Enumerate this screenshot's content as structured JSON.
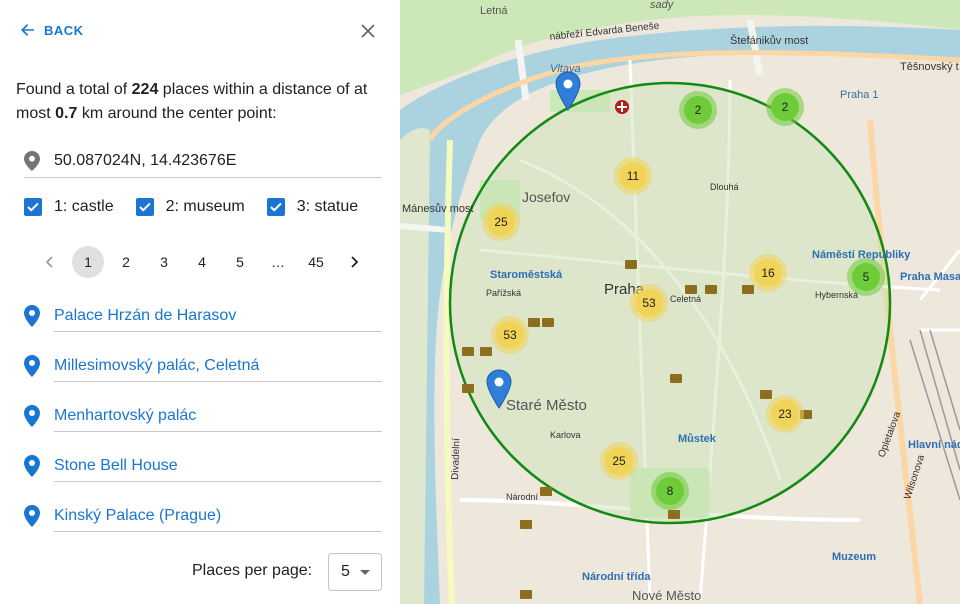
{
  "panel": {
    "back_label": "BACK",
    "summary": {
      "prefix": "Found a total of",
      "count": "224",
      "middle": "places within a distance of at most",
      "distance": "0.7",
      "suffix": "km around the center point:"
    },
    "center_point": "50.087024N, 14.423676E",
    "filters": [
      {
        "label": "1: castle",
        "checked": true
      },
      {
        "label": "2: museum",
        "checked": true
      },
      {
        "label": "3: statue",
        "checked": true
      }
    ],
    "pagination": {
      "current": "1",
      "pages": [
        "1",
        "2",
        "3",
        "4",
        "5",
        "…",
        "45"
      ]
    },
    "results": [
      "Palace Hrzán de Harasov",
      "Millesimovský palác, Celetná",
      "Menhartovský palác",
      "Stone Bell House",
      "Kinský Palace (Prague)"
    ],
    "per_page_label": "Places per page:",
    "per_page_value": "5"
  },
  "map": {
    "clusters": [
      {
        "id": "a",
        "count": "2",
        "color": "green"
      },
      {
        "id": "b",
        "count": "2",
        "color": "green"
      },
      {
        "id": "c",
        "count": "11",
        "color": "yellow"
      },
      {
        "id": "d",
        "count": "25",
        "color": "yellow"
      },
      {
        "id": "e",
        "count": "16",
        "color": "yellow"
      },
      {
        "id": "f",
        "count": "5",
        "color": "green"
      },
      {
        "id": "g",
        "count": "53",
        "color": "yellow"
      },
      {
        "id": "h",
        "count": "53",
        "color": "yellow"
      },
      {
        "id": "i",
        "count": "23",
        "color": "yellow"
      },
      {
        "id": "j",
        "count": "25",
        "color": "yellow"
      },
      {
        "id": "k",
        "count": "8",
        "color": "green"
      }
    ],
    "labels": {
      "river": "Vltava",
      "embankment": "nábřeží Edvarda Beneše",
      "bridge_top": "Štefánikův most",
      "manes": "Mánesův most",
      "josefov": "Josefov",
      "staromestska": "Staroměstská",
      "praha": "Praha",
      "stare_mesto": "Staré Město",
      "namesti_republiky": "Náměstí Republiky",
      "masaryk": "Praha Masarykovo nádraží",
      "hlavni": "Hlavní nádraží",
      "mustek": "Můstek",
      "narodni": "Národní třída",
      "muzeum": "Muzeum",
      "nove_mesto": "Nové Město",
      "praha1": "Praha 1",
      "nabrezi_top": "nábřeží Edvarda Beneše",
      "letna": "Letná",
      "sady": "sady",
      "tesnov": "Těšnovský t",
      "dlouha": "Dlouhá",
      "celetna": "Celetná",
      "hybernska": "Hybernská",
      "wilsonova": "Wilsonova",
      "opletalova": "Opletalova",
      "divadelni": "Divadelní",
      "parizska": "Pařížská",
      "karlova": "Karlova",
      "narodni_st": "Národní"
    },
    "colors": {
      "ring": "#138a13",
      "pin": "#2f7ed8",
      "cluster_yellow": "#f1d357",
      "cluster_green": "#6ecc39",
      "water": "#aad3df",
      "land": "#eee7dc"
    }
  }
}
